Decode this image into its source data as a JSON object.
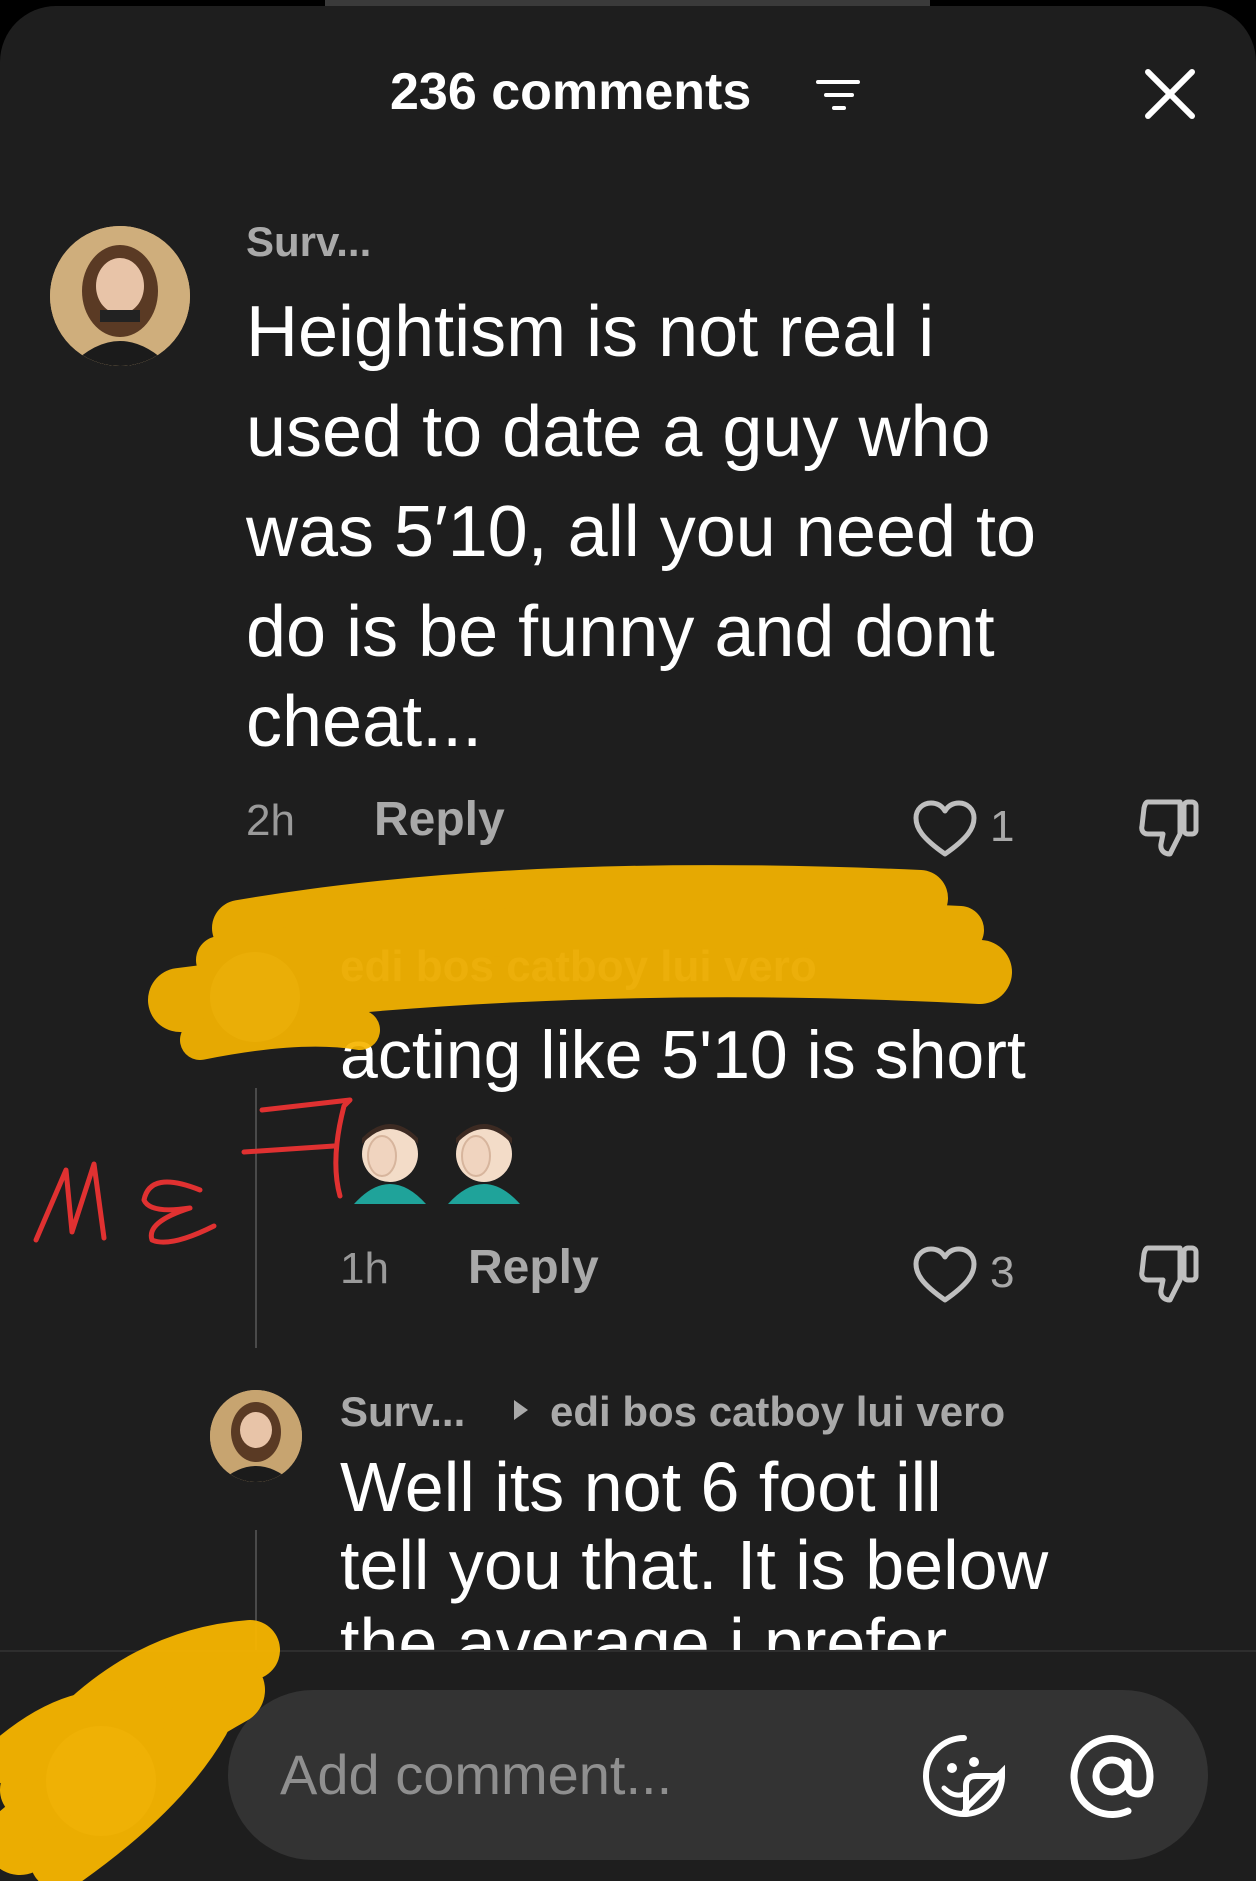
{
  "header": {
    "title": "236 comments"
  },
  "comments": [
    {
      "username": "Surv...",
      "text_lines": [
        "Heightism is not real i",
        "used to date a guy who",
        "was 5′10, all you need to",
        "do is be funny and dont",
        "cheat..."
      ],
      "time": "2h",
      "reply_label": "Reply",
      "likes": "1"
    }
  ],
  "replies": [
    {
      "username": "edi bos catboy lui vero",
      "text_line_1": "acting like 5'10 is short",
      "time": "1h",
      "reply_label": "Reply",
      "likes": "3"
    },
    {
      "username": "Surv...",
      "reply_to": "edi bos catboy lui vero",
      "text_lines": [
        "Well its not 6 foot ill",
        "tell you that. It is below",
        "the average i prefer"
      ]
    }
  ],
  "annotation": {
    "handwritten": "ME"
  },
  "composer": {
    "placeholder": "Add comment..."
  },
  "colors": {
    "sheet_bg": "#1e1e1e",
    "highlighter": "#f7b500",
    "annotation_red": "#e03131"
  }
}
